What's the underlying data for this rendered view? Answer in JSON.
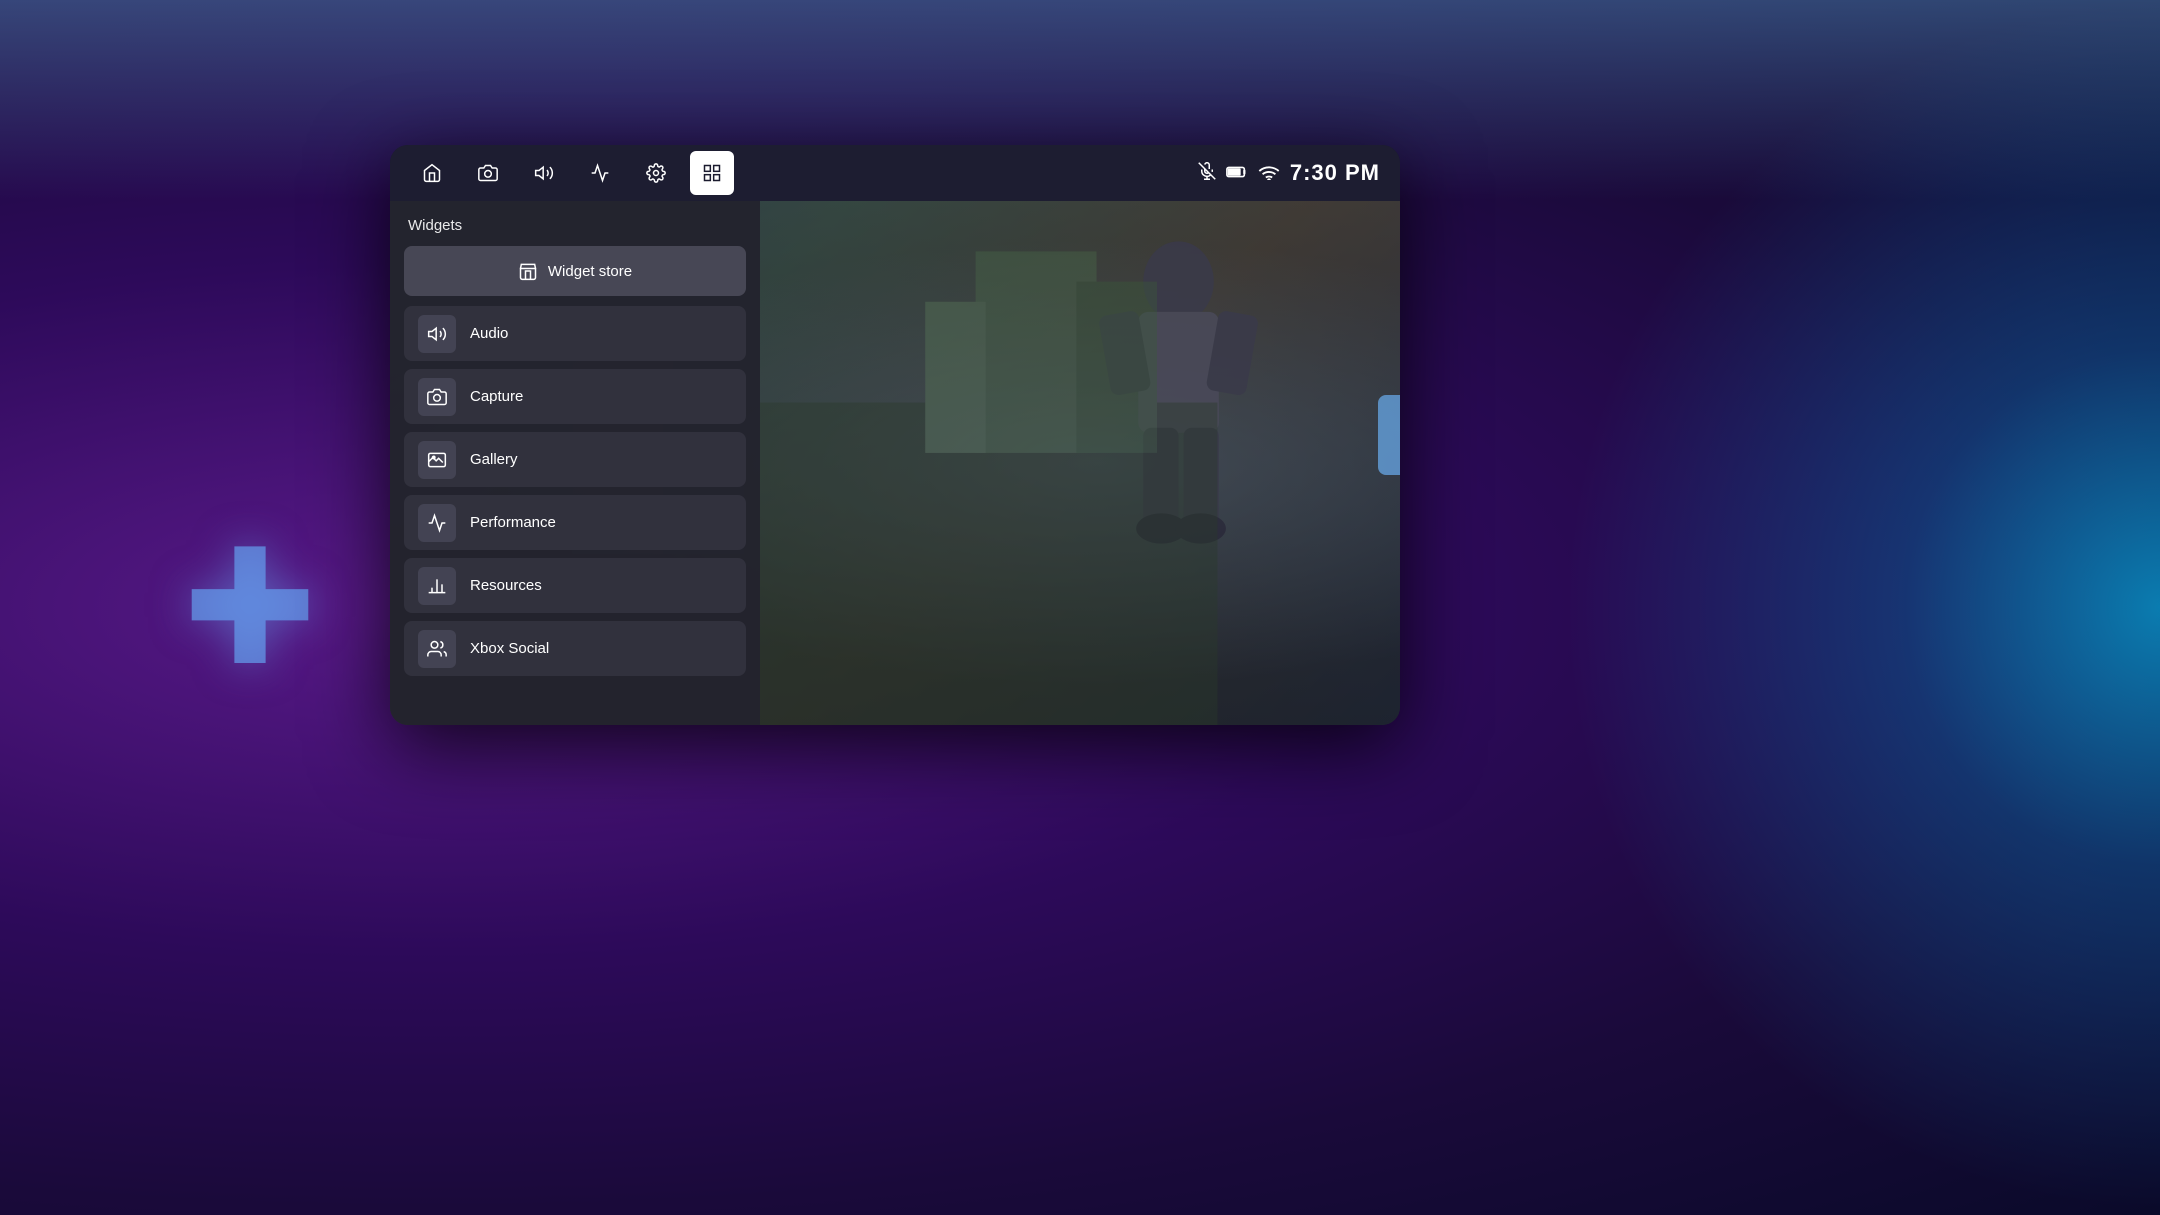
{
  "background": {
    "description": "Dark purple gradient background with cyan glow on right"
  },
  "device": {
    "topbar": {
      "nav_items": [
        {
          "id": "home",
          "label": "Home",
          "icon": "home",
          "active": false
        },
        {
          "id": "camera",
          "label": "Camera",
          "icon": "camera",
          "active": false
        },
        {
          "id": "audio",
          "label": "Audio",
          "icon": "volume",
          "active": false
        },
        {
          "id": "performance",
          "label": "Performance",
          "icon": "chart",
          "active": false
        },
        {
          "id": "settings",
          "label": "Settings",
          "icon": "gear",
          "active": false
        },
        {
          "id": "widgets",
          "label": "Widgets",
          "icon": "grid",
          "active": true
        }
      ],
      "status": {
        "mic_muted": true,
        "battery": "battery",
        "wifi": "wifi",
        "time": "7:30 PM"
      }
    },
    "widget_panel": {
      "title": "Widgets",
      "store_button": "Widget store",
      "items": [
        {
          "id": "audio",
          "label": "Audio",
          "icon": "volume"
        },
        {
          "id": "capture",
          "label": "Capture",
          "icon": "camera"
        },
        {
          "id": "gallery",
          "label": "Gallery",
          "icon": "gallery"
        },
        {
          "id": "performance",
          "label": "Performance",
          "icon": "chart"
        },
        {
          "id": "resources",
          "label": "Resources",
          "icon": "bar-chart"
        },
        {
          "id": "xbox-social",
          "label": "Xbox Social",
          "icon": "people"
        }
      ]
    }
  },
  "plus_icon": "＋"
}
